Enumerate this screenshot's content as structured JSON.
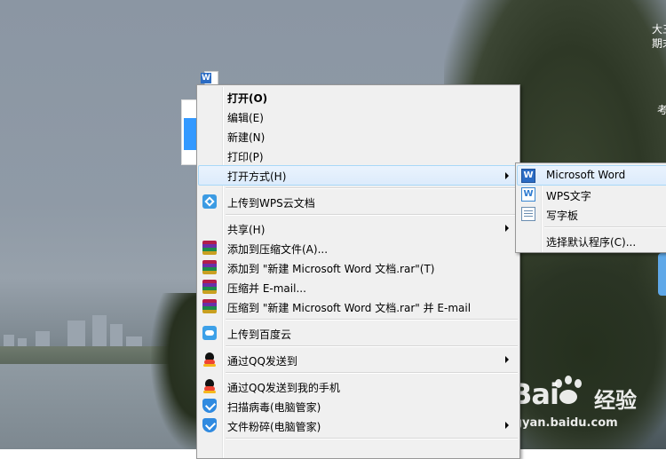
{
  "desktop": {
    "top_right_line1": "大三",
    "top_right_line2": "期末",
    "right_text": "考"
  },
  "file": {
    "icon_letter": "W"
  },
  "context_menu": {
    "items": [
      {
        "label": "打开(O)",
        "bold": true
      },
      {
        "label": "编辑(E)"
      },
      {
        "label": "新建(N)"
      },
      {
        "label": "打印(P)"
      },
      {
        "label": "打开方式(H)",
        "has_submenu": true,
        "highlighted": true
      },
      {
        "label": "上传到WPS云文档",
        "icon": "wps-cloud-icon"
      },
      {
        "label": "共享(H)",
        "has_submenu": true
      },
      {
        "label": "添加到压缩文件(A)...",
        "icon": "winrar-icon"
      },
      {
        "label": "添加到 \"新建 Microsoft Word 文档.rar\"(T)",
        "icon": "winrar-icon"
      },
      {
        "label": "压缩并 E-mail...",
        "icon": "winrar-icon"
      },
      {
        "label": "压缩到 \"新建 Microsoft Word 文档.rar\" 并 E-mail",
        "icon": "winrar-icon"
      },
      {
        "label": "上传到百度云",
        "icon": "baidu-cloud-icon"
      },
      {
        "label": "通过QQ发送到",
        "icon": "qq-icon",
        "has_submenu": true
      },
      {
        "label": "通过QQ发送到我的手机",
        "icon": "qq-icon"
      },
      {
        "label": "扫描病毒(电脑管家)",
        "icon": "shield-icon"
      },
      {
        "label": "文件粉碎(电脑管家)",
        "icon": "shield-icon",
        "has_submenu": true
      }
    ]
  },
  "open_with_submenu": {
    "items": [
      {
        "label": "Microsoft Word",
        "icon": "word-icon",
        "highlighted": true
      },
      {
        "label": "WPS文字",
        "icon": "wps-writer-icon"
      },
      {
        "label": "写字板",
        "icon": "wordpad-icon"
      },
      {
        "label": "选择默认程序(C)...",
        "icon": ""
      }
    ]
  },
  "watermark": {
    "brand": "Bai",
    "suffix": "经验",
    "url": "ingyan.baidu.com"
  },
  "colors": {
    "menu_bg": "#f0f0f0",
    "highlight_bg": "#dcebfc",
    "highlight_border": "#a8d8f8"
  }
}
